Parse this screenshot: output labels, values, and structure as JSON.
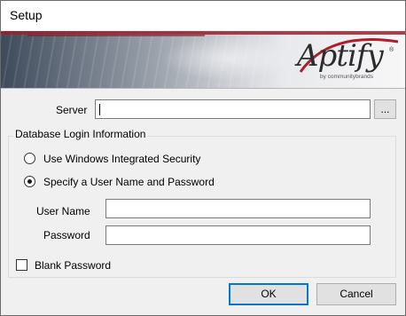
{
  "window": {
    "title": "Setup"
  },
  "banner": {
    "logo_text": "Aptify",
    "logo_mark": "®",
    "logo_tagline": "by communitybrands"
  },
  "server": {
    "label": "Server",
    "value": "",
    "browse_label": "..."
  },
  "db_login": {
    "group_title": "Database Login Information",
    "options": [
      {
        "label": "Use Windows Integrated Security",
        "selected": false
      },
      {
        "label": "Specify a User Name and Password",
        "selected": true
      }
    ],
    "username": {
      "label": "User Name",
      "value": ""
    },
    "password": {
      "label": "Password",
      "value": ""
    },
    "blank_password": {
      "label": "Blank Password",
      "checked": false
    }
  },
  "buttons": {
    "ok_label": "OK",
    "cancel_label": "Cancel"
  },
  "colors": {
    "accent": "#0078d7",
    "banner_red": "#a21d2a"
  }
}
